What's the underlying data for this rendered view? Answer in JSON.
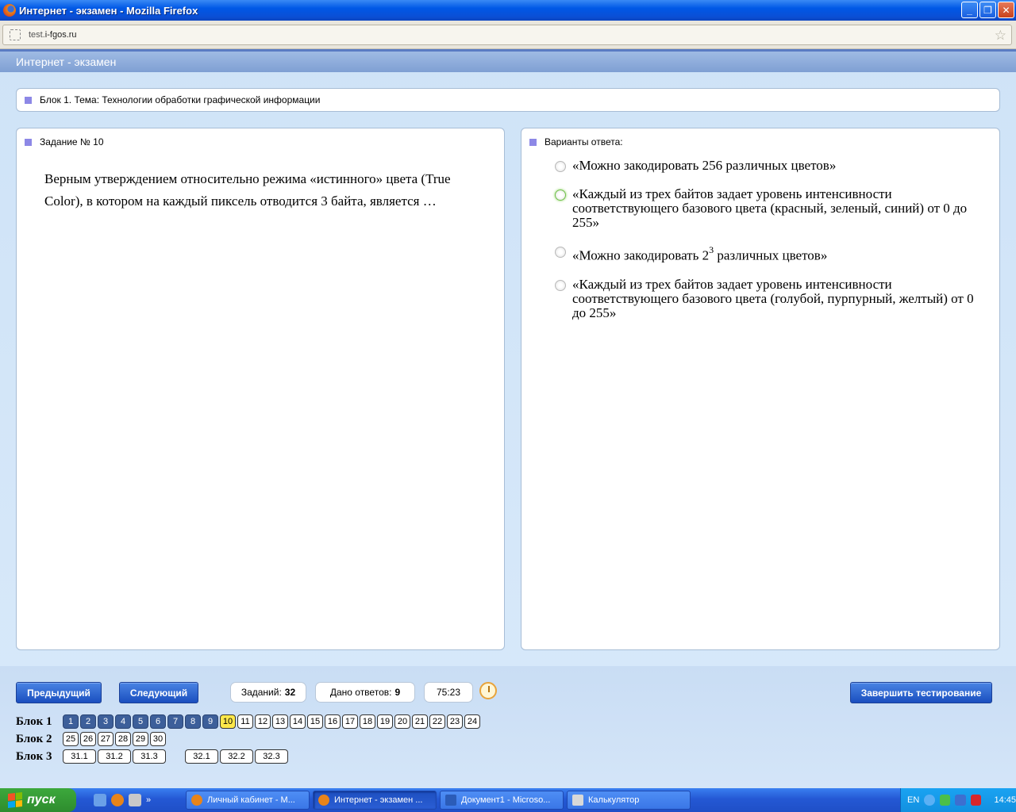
{
  "window": {
    "title": "Интернет - экзамен - Mozilla Firefox",
    "buttons": [
      "minimize",
      "maximize",
      "close"
    ]
  },
  "browser": {
    "url_prefix": "test.",
    "url_host": "i-fgos.ru"
  },
  "app": {
    "header": "Интернет - экзамен"
  },
  "block_bar": {
    "text": "Блок 1. Тема: Технологии обработки графической информации"
  },
  "task_panel": {
    "heading": "Задание № 10",
    "question": "Верным утверждением относительно режима «истинного» цвета (True Color), в котором на каждый пиксель отводится 3 байта, является …"
  },
  "answers_panel": {
    "heading": "Варианты ответа:",
    "options": [
      {
        "text": "«Можно закодировать 256 различных цветов»"
      },
      {
        "text": "«Каждый из трех байтов задает уровень интенсивности соответствующего базового цвета (красный, зеленый, синий) от 0 до 255»"
      },
      {
        "text_before": "«Можно закодировать 2",
        "sup": "3",
        "text_after": " различных цветов»"
      },
      {
        "text": "«Каждый из трех байтов задает уровень интенсивности соответствующего базового цвета (голубой, пурпурный, желтый) от 0 до 255»"
      }
    ]
  },
  "controls": {
    "prev": "Предыдущий",
    "next": "Следующий",
    "tasks_label": "Заданий:",
    "tasks_value": "32",
    "answers_label": "Дано ответов:",
    "answers_value": "9",
    "timer": "75:23",
    "finish": "Завершить тестирование"
  },
  "navigation": {
    "block1": {
      "label": "Блок 1",
      "items": [
        "1",
        "2",
        "3",
        "4",
        "5",
        "6",
        "7",
        "8",
        "9",
        "10",
        "11",
        "12",
        "13",
        "14",
        "15",
        "16",
        "17",
        "18",
        "19",
        "20",
        "21",
        "22",
        "23",
        "24"
      ],
      "answered": [
        "1",
        "2",
        "3",
        "4",
        "5",
        "6",
        "7",
        "8",
        "9"
      ],
      "current": "10"
    },
    "block2": {
      "label": "Блок 2",
      "items": [
        "25",
        "26",
        "27",
        "28",
        "29",
        "30"
      ]
    },
    "block3": {
      "label": "Блок 3",
      "items_a": [
        "31.1",
        "31.2",
        "31.3"
      ],
      "items_b": [
        "32.1",
        "32.2",
        "32.3"
      ]
    }
  },
  "taskbar": {
    "start": "пуск",
    "tasks": [
      "Личный кабинет - M...",
      "Интернет - экзамен ...",
      "Документ1 - Microso...",
      "Калькулятор"
    ],
    "lang": "EN",
    "time": "14:45"
  },
  "colors": {
    "answered": "#3d5f9a",
    "current": "#fde84a",
    "button": "#1a4fbf",
    "marker": "#8d88e6"
  }
}
